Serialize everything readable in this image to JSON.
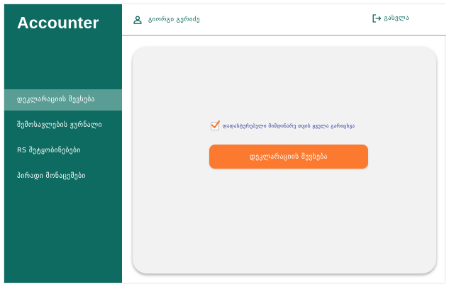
{
  "app": {
    "brand": "Accounter"
  },
  "sidebar": {
    "items": [
      {
        "label": "დეკლარაციის შევსება",
        "active": true
      },
      {
        "label": "შემოსავლების ჟურნალი",
        "active": false
      },
      {
        "label": "RS შეტყობინებები",
        "active": false
      },
      {
        "label": "პირადი მონაცემები",
        "active": false
      }
    ]
  },
  "header": {
    "user_name": "გიორგი გერიძე",
    "user_icon": "user-icon",
    "logout_label": "გასვლა",
    "logout_icon": "logout-icon"
  },
  "form": {
    "consent_label": "დადასტურებული მიმდინარე თვის ყველა გარიცხვა",
    "consent_checked": true,
    "submit_label": "დეკლარაციის შევსება"
  },
  "colors": {
    "sidebar": "#0e6b61",
    "active_item": "#5a9d95",
    "accent": "#fb7a30",
    "consent_text": "#2b3a9a"
  }
}
